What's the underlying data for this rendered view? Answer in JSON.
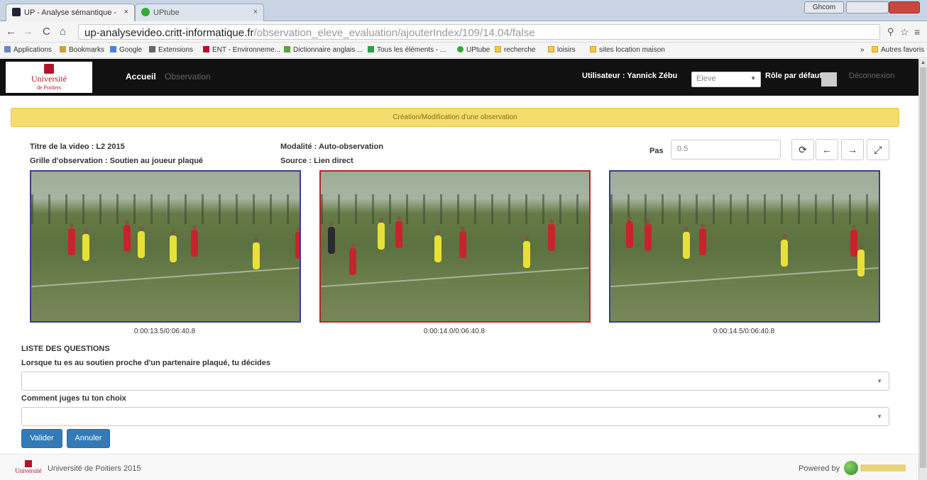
{
  "browser": {
    "tabs": [
      {
        "label": "UP - Analyse sémantique - ",
        "close": "×"
      },
      {
        "label": "UPtube",
        "close": "×"
      }
    ],
    "window_controls": {
      "user": "Ghcom",
      "minimize": "",
      "close": ""
    },
    "url": {
      "host": "up-analysevideo.critt-informatique.fr",
      "path": "/observation_eleve_evaluation/ajouterIndex/109/14.04/false"
    },
    "bookmarks": [
      "Applications",
      "Bookmarks",
      "Google",
      "Extensions",
      "ENT - Environneme...",
      "Dictionnaire anglais ...",
      "Tous les éléments - ...",
      "UPtube",
      "recherche",
      "loisirs",
      "sites location maison"
    ],
    "other_bookmarks": "Autres favoris",
    "overflow": "»"
  },
  "header": {
    "logo_name": "Université",
    "logo_sub": "de Poitiers",
    "nav": {
      "home": "Accueil",
      "observation": "Observation"
    },
    "user_label": "Utilisateur : Yannick Zébu",
    "role_value": "Eleve",
    "default_role_label": "Rôle par défaut",
    "logout": "Déconnexion"
  },
  "banner": "Création/Modification d'une observation",
  "meta": {
    "video_title": "Titre de la video : L2 2015",
    "grid": "Grille d'observation : Soutien au joueur plaqué",
    "modality": "Modalité : Auto-observation",
    "source": "Source : Lien direct"
  },
  "controls": {
    "pas_label": "Pas",
    "pas_value": "0.5"
  },
  "frames": [
    {
      "timestamp": "0:00:13.5/0:06:40.8",
      "border": "#3c3c8c"
    },
    {
      "timestamp": "0:00:14.0/0:06:40.8",
      "border": "#b22a2a"
    },
    {
      "timestamp": "0:00:14.5/0:06:40.8",
      "border": "#3c3c8c"
    }
  ],
  "questions": {
    "heading": "LISTE DES QUESTIONS",
    "items": [
      {
        "label": "Lorsque tu es au soutien proche d'un partenaire plaqué, tu décides"
      },
      {
        "label": "Comment juges tu ton choix"
      }
    ]
  },
  "buttons": {
    "validate": "Valider",
    "cancel": "Annuler"
  },
  "footer": {
    "copyright": "Université de Poitiers 2015",
    "powered": "Powered by",
    "logo_name": "Université"
  },
  "colors": {
    "nav_bg": "#111111",
    "banner_bg": "#f6dc6a",
    "primary_button": "#337ab7"
  }
}
